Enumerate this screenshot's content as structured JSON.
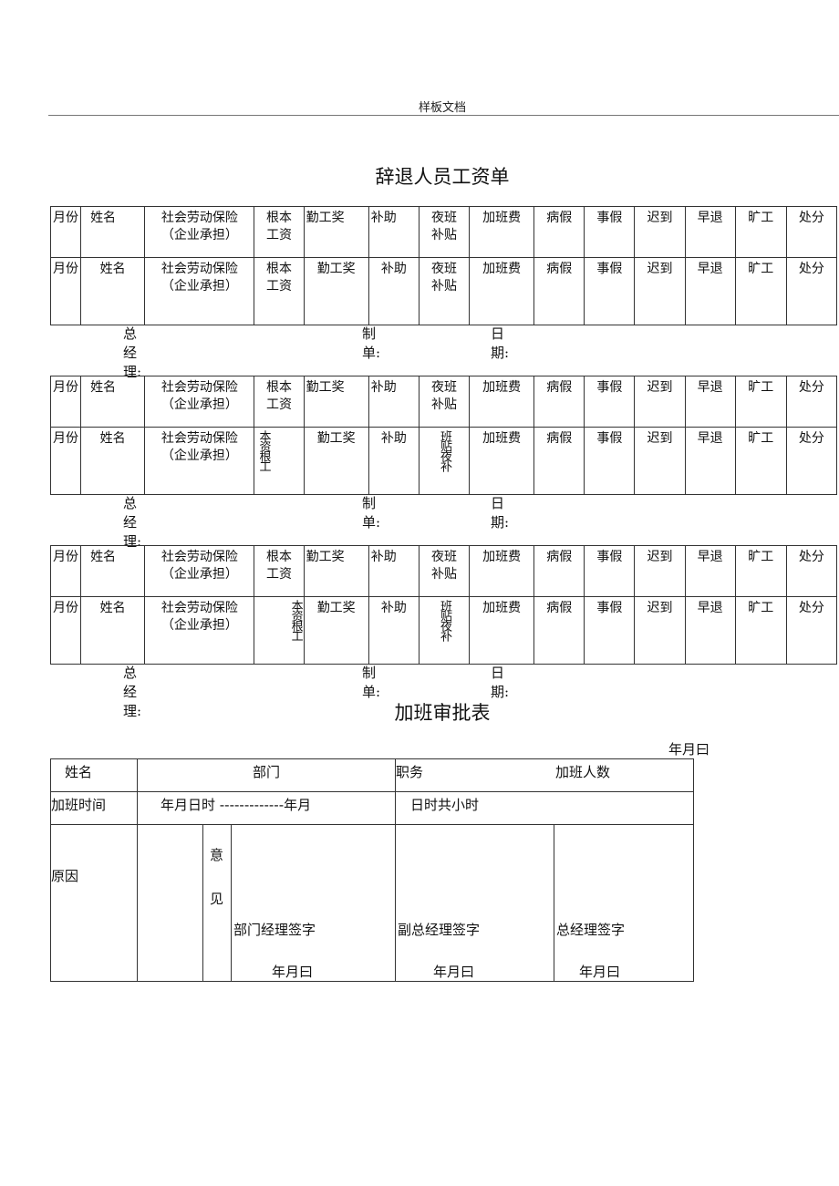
{
  "header": {
    "text": "样板文档"
  },
  "wage_section": {
    "title": "辞退人员工资单",
    "columns": [
      "月份",
      "姓名",
      "社会劳动保险（企业承担）",
      "根本工资",
      "勤工奖",
      "补助",
      "夜班补贴",
      "加班费",
      "病假",
      "事假",
      "迟到",
      "早退",
      "旷工",
      "处分"
    ],
    "row_labels": {
      "month": "月份",
      "name": "姓名",
      "insurance_line1": "社会劳动保险",
      "insurance_line2": "（企业承担）",
      "base_wage_line1": "根本",
      "base_wage_line2": "工资",
      "base_wage_vertical": "本资根工",
      "attendance_bonus": "勤工奖",
      "subsidy": "补助",
      "night_line1": "夜班",
      "night_line2": "补贴",
      "night_vertical": "班贴夜补",
      "overtime_pay": "加班费",
      "sick_leave": "病假",
      "personal_leave": "事假",
      "late": "迟到",
      "early_leave": "早退",
      "absent": "旷工",
      "penalty": "处分"
    },
    "footer": {
      "gm": "总经理:",
      "prepared_by": "制单:",
      "date": "日期:"
    }
  },
  "overtime_section": {
    "title": "加班审批表",
    "date_top": "年月曰",
    "name_label": "姓名",
    "dept_label": "部门",
    "position_label": "职务",
    "count_label": "加班人数",
    "time_label": "加班时间",
    "time_range_start": "年月日时 -------------年月",
    "time_range_end": "日时共小时",
    "reason_label": "原因",
    "opinion_char1": "意",
    "opinion_char2": "见",
    "dept_manager_sign": "部门经理签字",
    "vice_gm_sign": "副总经理签字",
    "gm_sign": "总经理签字",
    "sign_date": "年月曰"
  }
}
